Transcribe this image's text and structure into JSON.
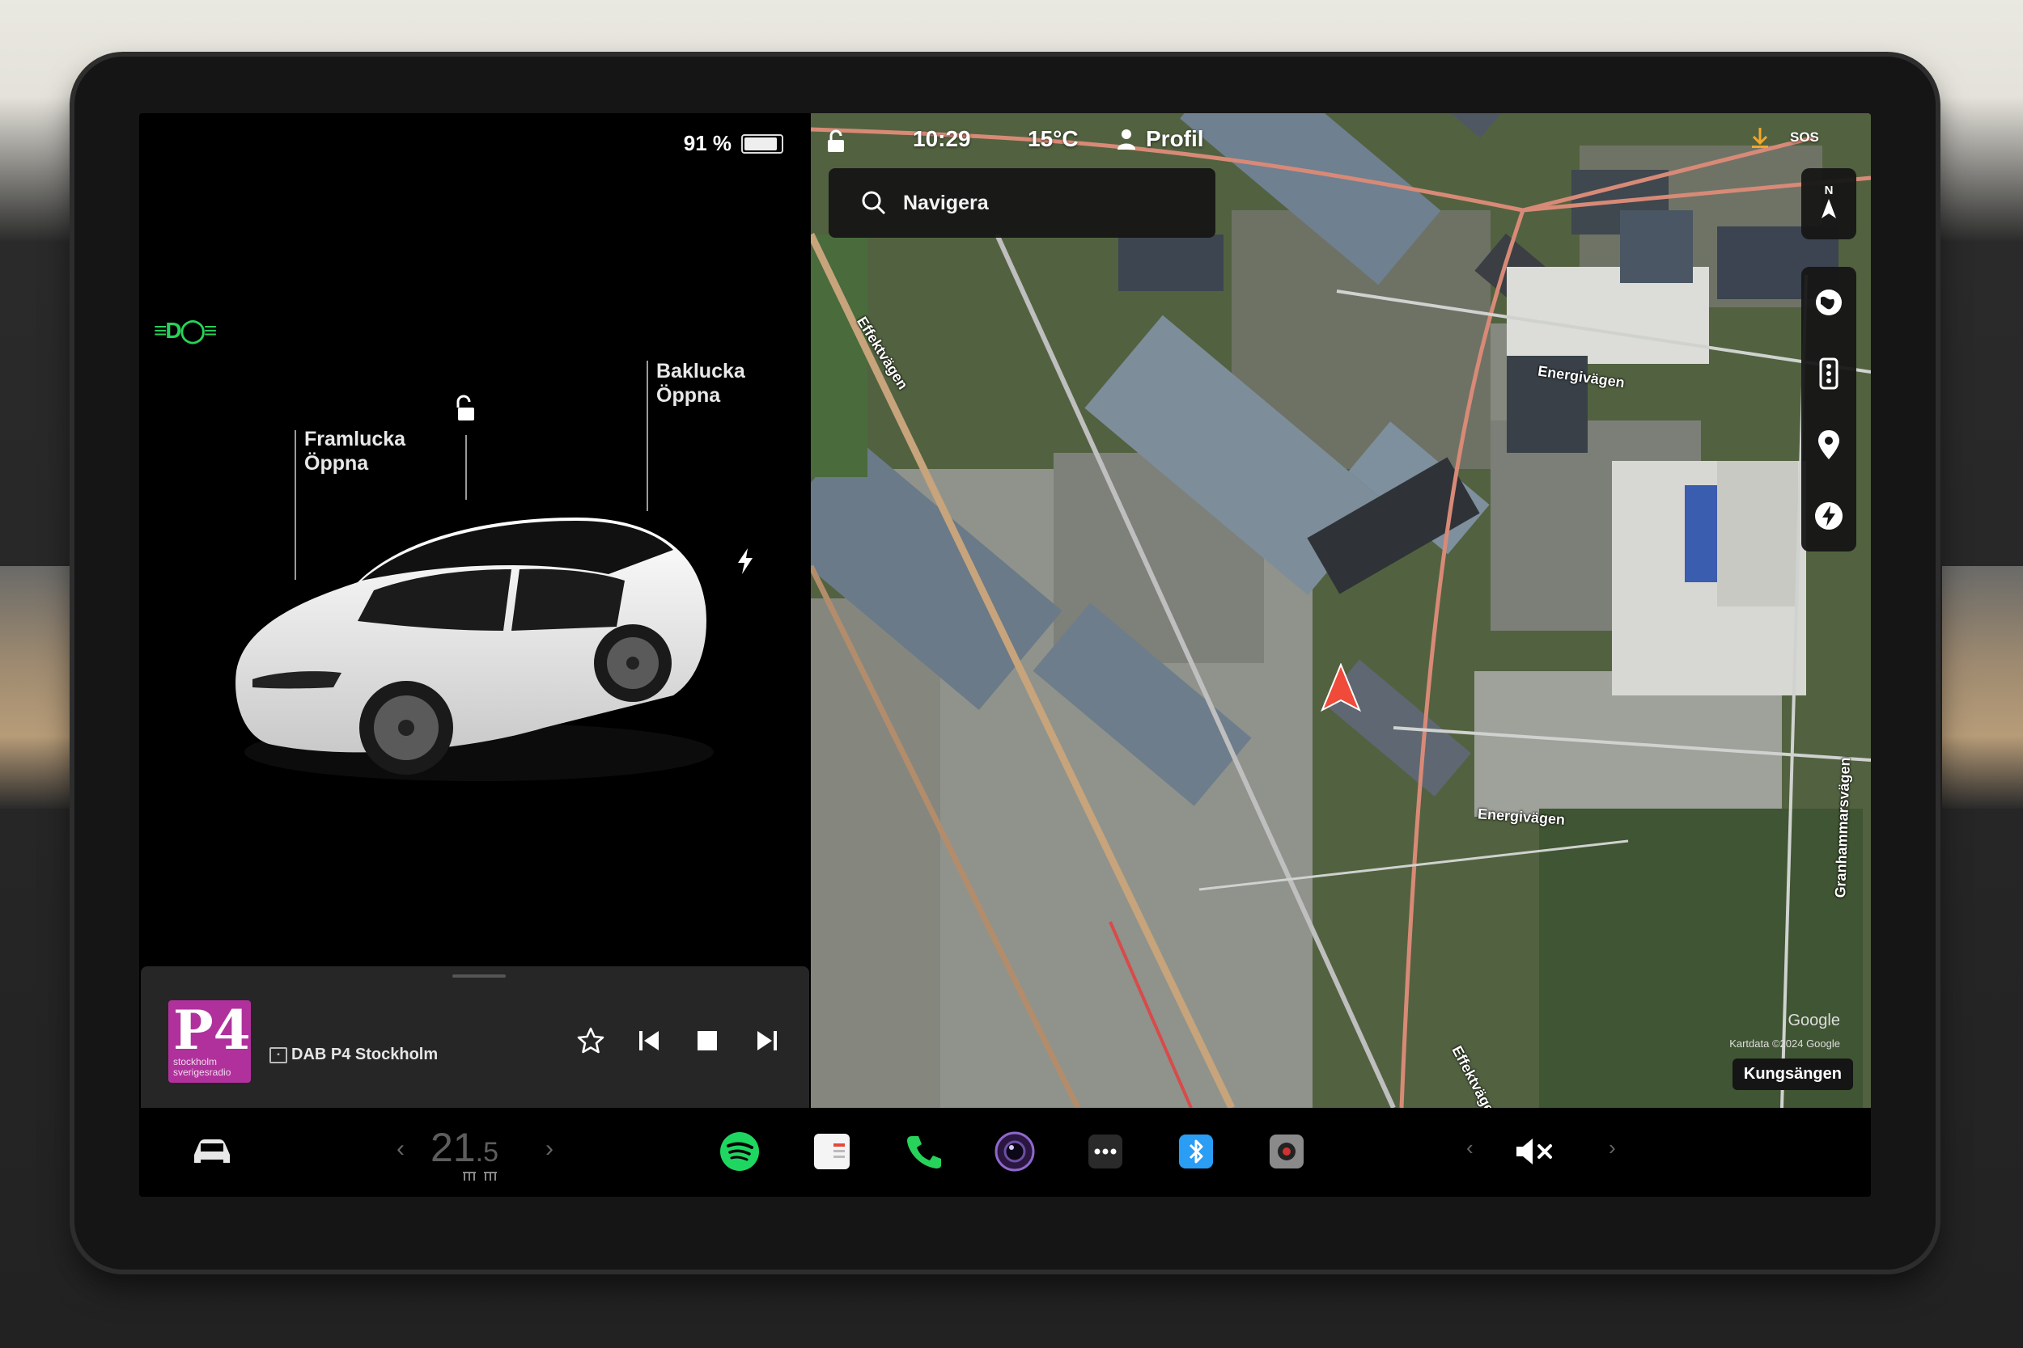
{
  "status": {
    "battery_percent": "91 %",
    "battery_level": 0.91,
    "time": "10:29",
    "temperature": "15°C",
    "profile": "Profil",
    "sos": "SOS"
  },
  "car": {
    "front_trunk_title": "Framlucka",
    "front_trunk_action": "Öppna",
    "rear_trunk_title": "Baklucka",
    "rear_trunk_action": "Öppna"
  },
  "media": {
    "logo_text": "P4",
    "logo_subtext": "stockholm sverigesradio",
    "source_badge": "DAB",
    "station": "DAB P4 Stockholm"
  },
  "map": {
    "search_placeholder": "Navigera",
    "compass": "N",
    "roads": [
      "Effektvägen",
      "Energivägen",
      "Energivägen",
      "Granhammarsvägen",
      "Effektvägen"
    ],
    "google": "Google",
    "map_data": "Kartdata ©2024 Google",
    "location": "Kungsängen"
  },
  "dock": {
    "cabin_temp": "21",
    "cabin_temp_decimal": ".5"
  },
  "colors": {
    "accent_green": "#27d35a",
    "p4_purple": "#b0319c",
    "nav_arrow": "#f04a3a",
    "bluetooth": "#2a9df4"
  }
}
